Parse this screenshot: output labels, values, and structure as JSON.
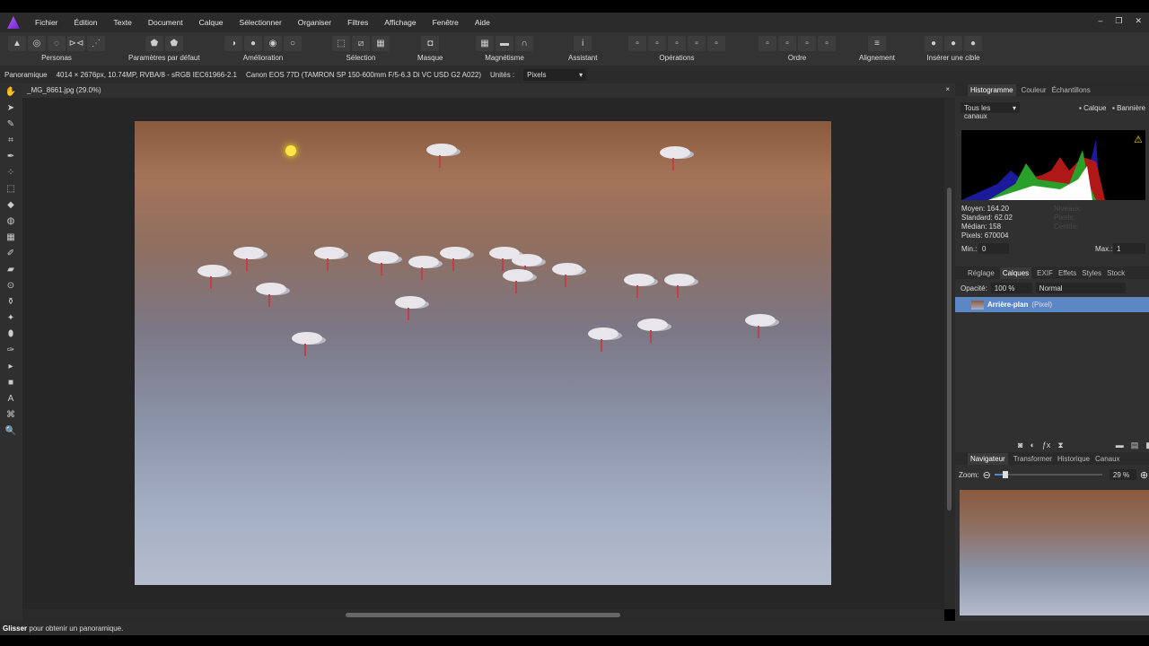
{
  "menu": [
    "Fichier",
    "Édition",
    "Texte",
    "Document",
    "Calque",
    "Sélectionner",
    "Organiser",
    "Filtres",
    "Affichage",
    "Fenêtre",
    "Aide"
  ],
  "window_controls": {
    "minimize": "–",
    "restore": "❐",
    "close": "✕"
  },
  "toolbar": {
    "groups": [
      {
        "label": "Personas",
        "icons": [
          "photo-persona",
          "liquify-persona",
          "develop-persona",
          "tone-mapping-persona",
          "export-persona"
        ]
      },
      {
        "label": "Paramètres par défaut",
        "icons": [
          "default-settings",
          "reset"
        ]
      },
      {
        "label": "Amélioration",
        "icons": [
          "auto-levels",
          "auto-contrast",
          "auto-colors",
          "auto-white-balance"
        ]
      },
      {
        "label": "Sélection",
        "icons": [
          "marquee",
          "deselect",
          "invert"
        ]
      },
      {
        "label": "Masque",
        "icons": [
          "quick-mask"
        ]
      },
      {
        "label": "Magnétisme",
        "icons": [
          "snap-grid",
          "snap-toggle",
          "magnet"
        ]
      },
      {
        "label": "Assistant",
        "icons": [
          "assistant"
        ]
      },
      {
        "label": "Opérations",
        "icons": [
          "op1",
          "op2",
          "op3",
          "op4",
          "op5"
        ]
      },
      {
        "label": "Ordre",
        "icons": [
          "o1",
          "o2",
          "o3",
          "o4"
        ]
      },
      {
        "label": "Alignement",
        "icons": [
          "align"
        ]
      },
      {
        "label": "Insérer une cible",
        "icons": [
          "t1",
          "t2",
          "t3"
        ]
      }
    ]
  },
  "context": {
    "tool": "Panoramique",
    "info": "4014 × 2676px, 10.74MP, RVBA/8 - sRGB IEC61966-2.1",
    "camera": "Canon EOS 77D (TAMRON SP 150-600mm F/5-6.3 Di VC USD G2 A022)",
    "units_label": "Unités :",
    "units": "Pixels"
  },
  "document": {
    "tab": "_MG_8661.jpg (29.0%)",
    "close": "×"
  },
  "histogram": {
    "tabs": [
      "Histogramme",
      "Couleur",
      "Échantillons"
    ],
    "channel": "Tous les canaux",
    "calque": "Calque",
    "banniere": "Bannière",
    "stats": [
      "Moyen: 164.20",
      "Standard: 62.02",
      "Médian: 158",
      "Pixels: 670004"
    ],
    "faint": [
      "Niveaux:",
      "Pixels:",
      "Centile:"
    ],
    "min_label": "Min.:",
    "min": "0",
    "max_label": "Max.:",
    "max": "1"
  },
  "layers": {
    "tabs": [
      "Réglage",
      "Calques",
      "EXIF",
      "Effets",
      "Styles",
      "Stock"
    ],
    "opacity_label": "Opacité:",
    "opacity": "100 %",
    "blend": "Normal",
    "layer_name": "Arrière-plan",
    "layer_type": "(Pixel)"
  },
  "navigator": {
    "tabs": [
      "Navigateur",
      "Transformer",
      "Historique",
      "Canaux"
    ],
    "zoom_label": "Zoom:",
    "zoom": "29 %",
    "zoom_fraction": 0.1
  },
  "status": {
    "bold": "Glisser",
    "text": "pour obtenir un panoramique."
  }
}
